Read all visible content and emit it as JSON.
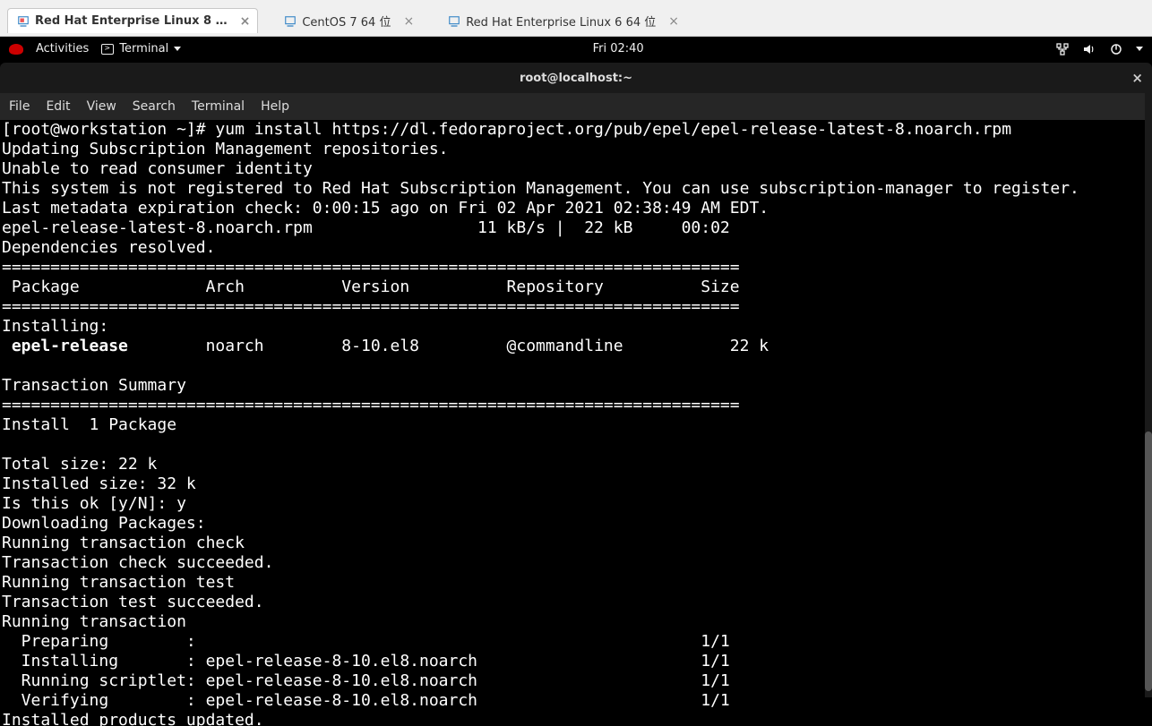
{
  "vm_tabs": [
    {
      "label": "Red Hat Enterprise Linux 8 …",
      "active": true
    },
    {
      "label": "CentOS 7 64 位",
      "active": false
    },
    {
      "label": "Red Hat Enterprise Linux 6 64 位",
      "active": false
    }
  ],
  "gnome": {
    "activities": "Activities",
    "app": "Terminal",
    "clock": "Fri 02:40"
  },
  "window": {
    "title": "root@localhost:~"
  },
  "menubar": [
    "File",
    "Edit",
    "View",
    "Search",
    "Terminal",
    "Help"
  ],
  "terminal": {
    "prompt": "[root@workstation ~]# ",
    "command": "yum install https://dl.fedoraproject.org/pub/epel/epel-release-latest-8.noarch.rpm",
    "lines_before_table": [
      "Updating Subscription Management repositories.",
      "Unable to read consumer identity",
      "This system is not registered to Red Hat Subscription Management. You can use subscription-manager to register.",
      "Last metadata expiration check: 0:00:15 ago on Fri 02 Apr 2021 02:38:49 AM EDT.",
      "epel-release-latest-8.noarch.rpm                 11 kB/s |  22 kB     00:02",
      "Dependencies resolved."
    ],
    "divider": "============================================================================",
    "header": " Package             Arch          Version          Repository          Size",
    "installing_label": "Installing:",
    "package_row": {
      "name": " epel-release",
      "rest": "        noarch        8-10.el8         @commandline           22 k"
    },
    "summary_label": "Transaction Summary",
    "install_count": "Install  1 Package",
    "sizes": [
      "Total size: 22 k",
      "Installed size: 32 k"
    ],
    "confirm": "Is this ok [y/N]: y",
    "lines_after": [
      "Downloading Packages:",
      "Running transaction check",
      "Transaction check succeeded.",
      "Running transaction test",
      "Transaction test succeeded.",
      "Running transaction",
      "  Preparing        :                                                    1/1",
      "  Installing       : epel-release-8-10.el8.noarch                       1/1",
      "  Running scriptlet: epel-release-8-10.el8.noarch                       1/1",
      "  Verifying        : epel-release-8-10.el8.noarch                       1/1",
      "Installed products updated."
    ]
  }
}
